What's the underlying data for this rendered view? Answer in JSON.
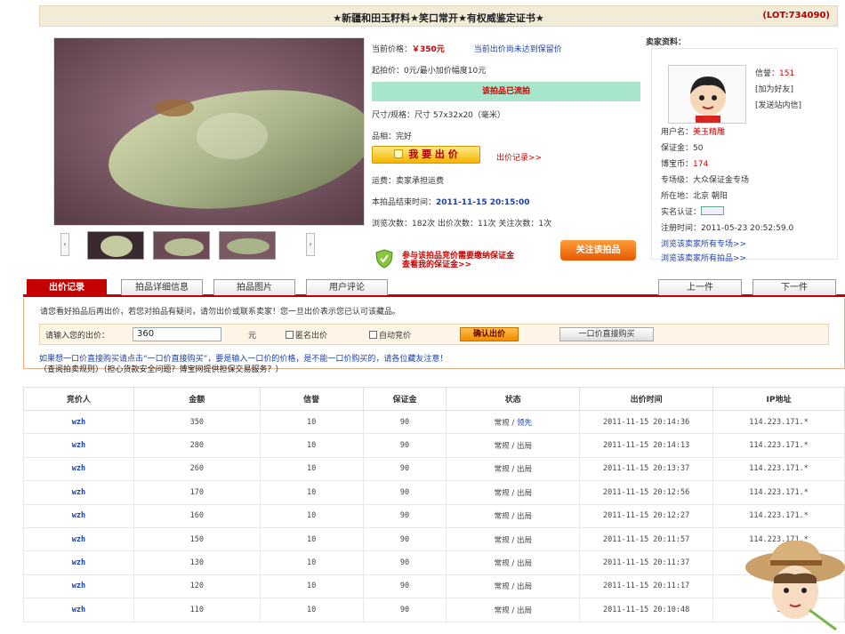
{
  "header": {
    "title": "★新疆和田玉籽料★笑口常开★有权威鉴定证书★",
    "lot": "(LOT:734090)"
  },
  "info": {
    "current_price_label": "当前价格：",
    "current_price": "￥350元",
    "reserve_note": "当前出价尚未达到保留价",
    "start_price": "起拍价：0元/最小加价幅度10元",
    "status": "该拍品已流拍",
    "size": "尺寸/规格：尺寸  57x32x20（毫米）",
    "condition": "品相：完好",
    "bid_button": "我 要 出 价",
    "bid_history_link": "出价记录>>",
    "shipping": "运费：卖家承担运费",
    "end_time_label": "本拍品结束时间：",
    "end_time": "2011-11-15  20:15:00",
    "stats": "浏览次数：182次 出价次数：11次 关注次数：1次"
  },
  "thumbs": {
    "prev": "‹",
    "next": "›"
  },
  "promo": {
    "line1": "参与该拍品竞价需要缴纳保证金",
    "line2": "查看我的保证金>>",
    "follow": "关注该拍品"
  },
  "seller": {
    "heading": "卖家资料：",
    "credit_label": "信誉：",
    "credit": "151",
    "add_friend": "[加为好友]",
    "send_message": "[发送站内信]",
    "username_label": "用户名：",
    "username": "美玉精雕",
    "deposit": "保证金：50",
    "coins_label": "博宝币：",
    "coins": "174",
    "zone": "专场级：大众保证金专场",
    "location": "所在地：北京 朝阳",
    "verify": "实名认证：",
    "register": "注册时间：2011-05-23 20:52:59.0",
    "link_zone": "浏览该卖家所有专场>>",
    "link_items": "浏览该卖家所有拍品>>"
  },
  "tabs": [
    "出价记录",
    "拍品详细信息",
    "拍品图片",
    "用户评论"
  ],
  "nav": {
    "prev": "上一件",
    "next": "下一件"
  },
  "bidpanel": {
    "notice": "请您看好拍品后再出价，若您对拍品有疑问，请勿出价或联系卖家！您一旦出价表示您已认可该藏品。",
    "input_label": "请输入您的出价：",
    "input_value": "360",
    "unit": "元",
    "anonymous": "匿名出价",
    "auto": "自动竞价",
    "confirm": "确认出价",
    "direct_buy": "一口价直接购买",
    "hint": "如果想一口价直接购买请点击“一口价直接购买”，要是输入一口价的价格，是不能一口价购买的，请各位藏友注意！",
    "links": "（查阅拍卖规则）（担心货款安全问题？博宝网提供担保交易服务？）"
  },
  "table": {
    "headers": [
      "竞价人",
      "金额",
      "信誉",
      "保证金",
      "状态",
      "出价时间",
      "IP地址"
    ],
    "rows": [
      [
        "wzh",
        "350",
        "10",
        "90",
        "常规 / ",
        "领先",
        "2011-11-15 20:14:36",
        "114.223.171.*"
      ],
      [
        "wzh",
        "280",
        "10",
        "90",
        "常规 / ",
        "出局",
        "2011-11-15 20:14:13",
        "114.223.171.*"
      ],
      [
        "wzh",
        "260",
        "10",
        "90",
        "常规 / ",
        "出局",
        "2011-11-15 20:13:37",
        "114.223.171.*"
      ],
      [
        "wzh",
        "170",
        "10",
        "90",
        "常规 / ",
        "出局",
        "2011-11-15 20:12:56",
        "114.223.171.*"
      ],
      [
        "wzh",
        "160",
        "10",
        "90",
        "常规 / ",
        "出局",
        "2011-11-15 20:12:27",
        "114.223.171.*"
      ],
      [
        "wzh",
        "150",
        "10",
        "90",
        "常规 / ",
        "出局",
        "2011-11-15 20:11:57",
        "114.223.171.*"
      ],
      [
        "wzh",
        "130",
        "10",
        "90",
        "常规 / ",
        "出局",
        "2011-11-15 20:11:37",
        "1"
      ],
      [
        "wzh",
        "120",
        "10",
        "90",
        "常规 / ",
        "出局",
        "2011-11-15 20:11:17",
        "1"
      ],
      [
        "wzh",
        "110",
        "10",
        "90",
        "常规 / ",
        "出局",
        "2011-11-15 20:10:48",
        "1"
      ]
    ]
  },
  "colors": {
    "accent": "#c40000",
    "link": "#1b3fb0",
    "status_bg": "#a8e6cc",
    "title_bg": "#f2ebd8"
  }
}
